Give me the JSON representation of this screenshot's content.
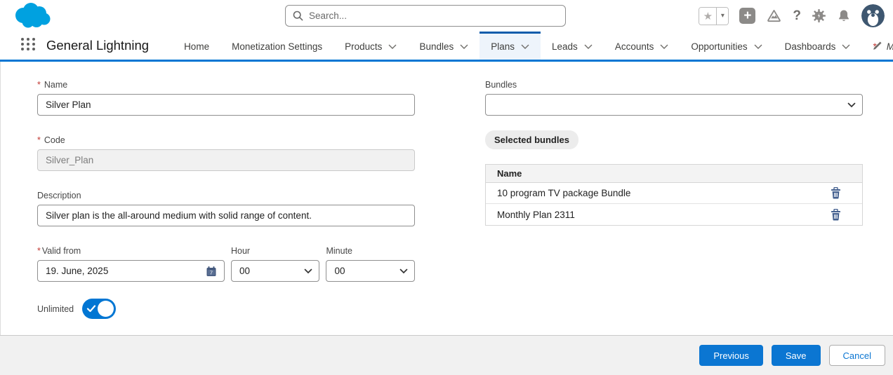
{
  "colors": {
    "brand_blue": "#0176d3",
    "nav_active_border": "#0b5cab",
    "required_red": "#c23934",
    "trash_blue": "#44608f",
    "cloud_blue": "#00a1e0",
    "avatar_bg": "#3e5770"
  },
  "header": {
    "search": {
      "placeholder": "Search..."
    },
    "icons": {
      "star_glyph": "★",
      "caret_glyph": "▾",
      "plus_glyph": "+",
      "help_glyph": "?"
    }
  },
  "nav": {
    "app_name": "General Lightning",
    "items": [
      {
        "label": "Home"
      },
      {
        "label": "Monetization Settings"
      },
      {
        "label": "Products"
      },
      {
        "label": "Bundles"
      },
      {
        "label": "Plans"
      },
      {
        "label": "Leads"
      },
      {
        "label": "Accounts"
      },
      {
        "label": "Opportunities"
      },
      {
        "label": "Dashboards"
      }
    ],
    "more": {
      "prefix": "*",
      "label": "More"
    }
  },
  "form": {
    "required_marker": "*",
    "name": {
      "label": "Name",
      "value": "Silver Plan"
    },
    "code": {
      "label": "Code",
      "value": "Silver_Plan"
    },
    "description": {
      "label": "Description",
      "value": "Silver plan is the all-around medium with solid range of content."
    },
    "valid_from": {
      "label": "Valid from",
      "value": "19. June, 2025",
      "calendar_day": "7"
    },
    "hour": {
      "label": "Hour",
      "value": "00"
    },
    "minute": {
      "label": "Minute",
      "value": "00"
    },
    "unlimited": {
      "label": "Unlimited",
      "state": "on"
    }
  },
  "bundles": {
    "label": "Bundles",
    "picker_value": "",
    "selected_badge": "Selected bundles",
    "table": {
      "header": "Name",
      "rows": [
        {
          "name": "10 program TV package Bundle"
        },
        {
          "name": "Monthly Plan 2311"
        }
      ]
    }
  },
  "footer": {
    "previous": "Previous",
    "save": "Save",
    "cancel": "Cancel"
  }
}
